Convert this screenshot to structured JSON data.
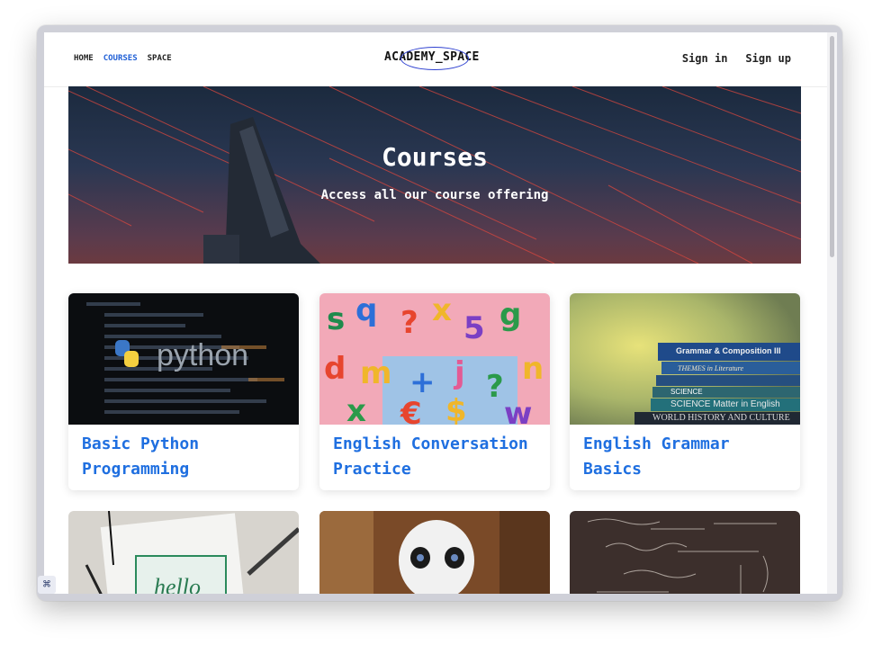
{
  "nav": {
    "items": [
      "HOME",
      "COURSES",
      "SPACE"
    ],
    "active_index": 1
  },
  "logo": {
    "text": "ACADEMY_SPACE"
  },
  "auth": {
    "sign_in": "Sign in",
    "sign_up": "Sign up"
  },
  "hero": {
    "title": "Courses",
    "subtitle": "Access all our course offering"
  },
  "cards": [
    {
      "title": "Basic Python Programming",
      "image": "python-code-photo",
      "image_text": "python"
    },
    {
      "title": "English Conversation Practice",
      "image": "colorful-letters-photo",
      "image_text": ""
    },
    {
      "title": "English Grammar Basics",
      "image": "stacked-books-photo",
      "image_text": "Grammar & Composition III"
    }
  ],
  "cards_row2": [
    {
      "image": "hello-lettering-photo",
      "image_text": "hello"
    },
    {
      "image": "robot-photo"
    },
    {
      "image": "chalkboard-math-photo"
    }
  ],
  "book_spines": [
    "Grammar & Composition III",
    "THEMES in Literature",
    "SCIENCE",
    "SCIENCE Matter in English",
    "WORLD HISTORY AND CULTURE"
  ],
  "colors": {
    "accent": "#1f6fe0",
    "nav_active": "#1f5fd6",
    "hero_bg": "#1b2a3e"
  }
}
